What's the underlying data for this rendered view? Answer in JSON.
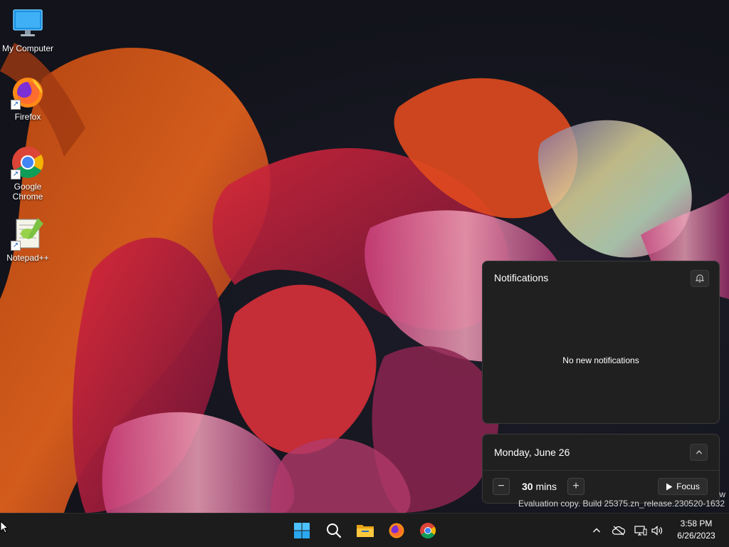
{
  "desktop": {
    "icons": [
      {
        "label": "My Computer",
        "icon": "monitor-icon"
      },
      {
        "label": "Firefox",
        "icon": "firefox-icon"
      },
      {
        "label": "Google Chrome",
        "icon": "chrome-icon"
      },
      {
        "label": "Notepad++",
        "icon": "notepad-plus-plus-icon"
      }
    ]
  },
  "notifications": {
    "title": "Notifications",
    "empty_text": "No new notifications",
    "settings_icon": "notification-settings-icon"
  },
  "calendar": {
    "date": "Monday, June 26",
    "collapse_icon": "chevron-up-icon",
    "focus_minutes": "30",
    "focus_unit": "mins",
    "decrease_label": "−",
    "increase_label": "+",
    "focus_label": "Focus"
  },
  "watermark": {
    "partial": "w",
    "build": "Evaluation copy. Build 25375.zn_release.230520-1632"
  },
  "taskbar": {
    "apps": [
      "start-icon",
      "search-icon",
      "file-explorer-icon",
      "firefox-icon",
      "chrome-icon"
    ],
    "tray": [
      "chevron-up-icon",
      "cloud-offline-icon",
      "network-icon",
      "volume-icon"
    ],
    "time": "3:58 PM",
    "date": "6/26/2023"
  },
  "colors": {
    "panel_bg": "#202020",
    "taskbar_bg": "#1c1c1c",
    "start_blue": "#4cc2ff"
  }
}
